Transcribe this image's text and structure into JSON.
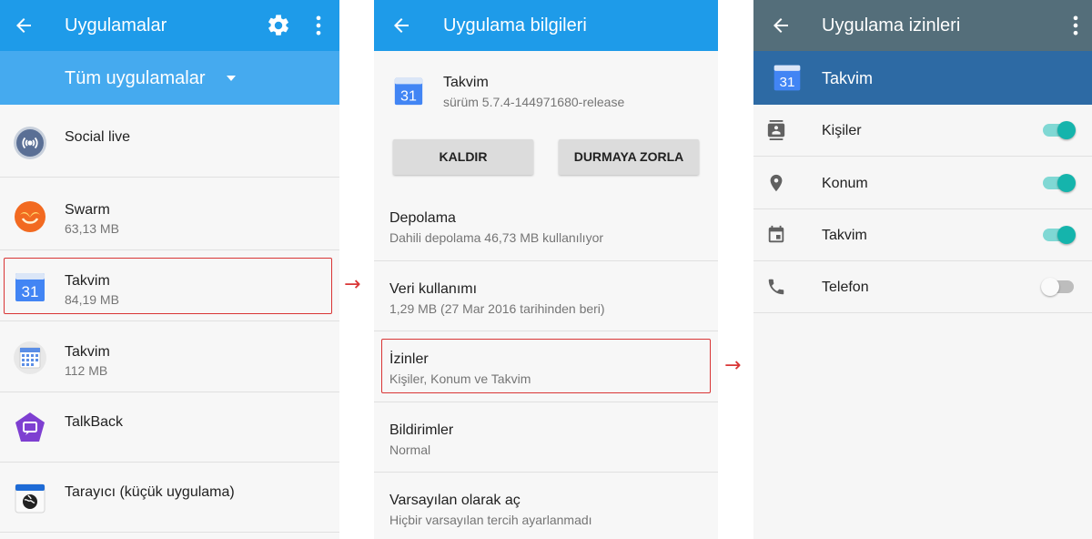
{
  "colors": {
    "appbar_blue": "#1e9be9",
    "subbar_blue": "#45aaef",
    "appbar_slate": "#546e7a",
    "app_header_blue": "#2d6aa4",
    "highlight_red": "#d93535",
    "toggle_on": "#15b4ac"
  },
  "arrows": {
    "first": "→",
    "second": "→"
  },
  "apps_screen": {
    "title": "Uygulamalar",
    "filter": "Tüm uygulamalar",
    "apps": [
      {
        "name": "Social live",
        "size": "",
        "icon": "social-live-icon"
      },
      {
        "name": "Swarm",
        "size": "63,13 MB",
        "icon": "swarm-icon"
      },
      {
        "name": "Takvim",
        "size": "84,19 MB",
        "icon": "google-calendar-icon",
        "highlighted": true
      },
      {
        "name": "Takvim",
        "size": "112 MB",
        "icon": "calendar-app-icon"
      },
      {
        "name": "TalkBack",
        "size": "",
        "icon": "talkback-icon"
      },
      {
        "name": "Tarayıcı (küçük uygulama)",
        "size": "",
        "icon": "browser-icon"
      }
    ]
  },
  "app_info_screen": {
    "title": "Uygulama bilgileri",
    "app_name": "Takvim",
    "version": "sürüm 5.7.4-144971680-release",
    "uninstall_label": "KALDIR",
    "force_stop_label": "DURMAYA ZORLA",
    "rows": [
      {
        "title": "Depolama",
        "subtitle": "Dahili depolama 46,73 MB kullanılıyor"
      },
      {
        "title": "Veri kullanımı",
        "subtitle": "1,29 MB (27 Mar 2016 tarihinden beri)"
      },
      {
        "title": "İzinler",
        "subtitle": "Kişiler, Konum ve Takvim",
        "highlighted": true
      },
      {
        "title": "Bildirimler",
        "subtitle": "Normal"
      },
      {
        "title": "Varsayılan olarak aç",
        "subtitle": "Hiçbir varsayılan tercih ayarlanmadı"
      }
    ]
  },
  "permissions_screen": {
    "title": "Uygulama izinleri",
    "app_name": "Takvim",
    "icon_day": "31",
    "permissions": [
      {
        "label": "Kişiler",
        "enabled": true,
        "icon": "contacts-icon"
      },
      {
        "label": "Konum",
        "enabled": true,
        "icon": "location-pin-icon"
      },
      {
        "label": "Takvim",
        "enabled": true,
        "icon": "calendar-icon"
      },
      {
        "label": "Telefon",
        "enabled": false,
        "icon": "phone-icon"
      }
    ]
  }
}
